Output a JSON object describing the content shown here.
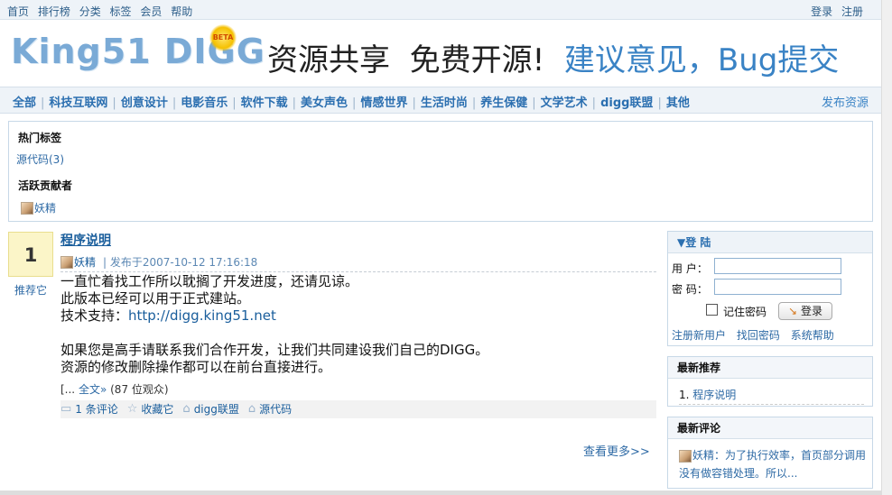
{
  "topbar": {
    "links": [
      "首页",
      "排行榜",
      "分类",
      "标签",
      "会员",
      "帮助"
    ],
    "login": "登录",
    "register": "注册"
  },
  "header": {
    "logo": "King51 DIGG",
    "logo_badge": "BETA",
    "slogan_1": "资源共享",
    "slogan_2": "免费开源!",
    "slogan_link": "建议意见，Bug提交"
  },
  "nav": {
    "items": [
      "全部",
      "科技互联网",
      "创意设计",
      "电影音乐",
      "软件下载",
      "美女声色",
      "情感世界",
      "生活时尚",
      "养生保健",
      "文学艺术",
      "digg联盟",
      "其他"
    ],
    "separator": "|",
    "publish": "发布资源"
  },
  "tagbox": {
    "hot_tags_heading": "热门标签",
    "hot_tag": "源代码(3)",
    "contributors_heading": "活跃贡献者",
    "contributor": "妖精"
  },
  "vote": {
    "count": "1",
    "recommend": "推荐它"
  },
  "article": {
    "title": "程序说明",
    "author": "妖精",
    "date": "| 发布于2007-10-12 17:16:18",
    "line1": "一直忙着找工作所以耽搁了开发进度，还请见谅。",
    "line2": "此版本已经可以用于正式建站。",
    "line3_label": "技术支持：",
    "line3_link": "http://digg.king51.net",
    "line4": "如果您是高手请联系我们合作开发，让我们共同建设我们自己的DIGG。",
    "line5": "资源的修改删除操作都可以在前台直接进行。",
    "more_prefix": "[...",
    "more_link": "全文»",
    "views": "(87 位观众)",
    "comments": "1 条评论",
    "favorite": "收藏它",
    "tag1": "digg联盟",
    "tag2": "源代码"
  },
  "see_more": "查看更多>>",
  "login": {
    "heading": "登 陆",
    "user_label": "用 户：",
    "pass_label": "密 码：",
    "remember": "记住密码",
    "button": "登录",
    "link_register": "注册新用户",
    "link_recover": "找回密码",
    "link_help": "系统帮助"
  },
  "new_recommend": {
    "heading": "最新推荐",
    "item_index": "1.",
    "item": "程序说明"
  },
  "new_comment": {
    "heading": "最新评论",
    "author": "妖精：",
    "text": "为了执行效率，首页部分调用没有做容错处理。所以..."
  },
  "colors": {
    "link": "#2e6aa5",
    "nav_bg": "#eef3f8",
    "border": "#c7d8e7",
    "vote_bg": "#fbf5c8"
  }
}
